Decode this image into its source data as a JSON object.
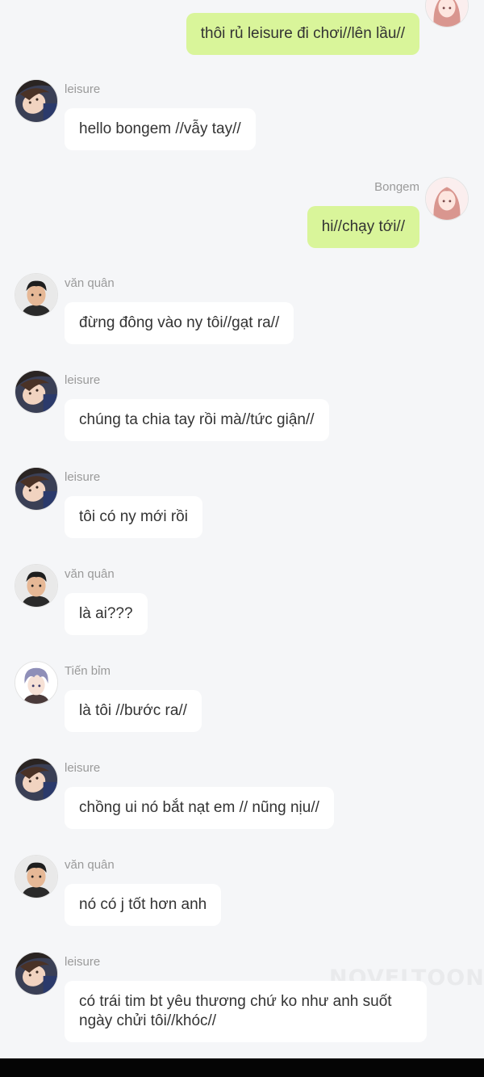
{
  "messages": [
    {
      "side": "right",
      "avatar": "girl",
      "name": "",
      "text": "thôi rủ leisure đi chơi//lên lầu//"
    },
    {
      "side": "left",
      "avatar": "leisure",
      "name": "leisure",
      "text": "hello bongem //vẫy tay//"
    },
    {
      "side": "right",
      "avatar": "girl",
      "name": "Bongem",
      "text": "hi//chạy tới//"
    },
    {
      "side": "left",
      "avatar": "man",
      "name": "văn quân",
      "text": "đừng đông vào ny tôi//gạt ra//"
    },
    {
      "side": "left",
      "avatar": "leisure",
      "name": "leisure",
      "text": "chúng ta chia tay rồi mà//tức giận//"
    },
    {
      "side": "left",
      "avatar": "leisure",
      "name": "leisure",
      "text": "tôi có ny mới rồi"
    },
    {
      "side": "left",
      "avatar": "man",
      "name": "văn quân",
      "text": "là ai???"
    },
    {
      "side": "left",
      "avatar": "boy",
      "name": "Tiến bỉm",
      "text": "là tôi //bước ra//"
    },
    {
      "side": "left",
      "avatar": "leisure",
      "name": "leisure",
      "text": "chồng ui nó bắt nạt em // nũng nịu//"
    },
    {
      "side": "left",
      "avatar": "man",
      "name": "văn quân",
      "text": "nó có j tốt hơn anh"
    },
    {
      "side": "left",
      "avatar": "leisure",
      "name": "leisure",
      "text": "có trái tim bt yêu thương chứ ko như anh suốt ngày chửi tôi//khóc//"
    }
  ],
  "watermark": "NOVELTOON",
  "avatars": {
    "girl": "girl-avatar-icon",
    "leisure": "leisure-avatar-icon",
    "man": "man-avatar-icon",
    "boy": "boy-avatar-icon"
  },
  "colors": {
    "background": "#f5f6f8",
    "own_bubble": "#d9f59a",
    "other_bubble": "#ffffff",
    "name_text": "#9a9a9a"
  }
}
